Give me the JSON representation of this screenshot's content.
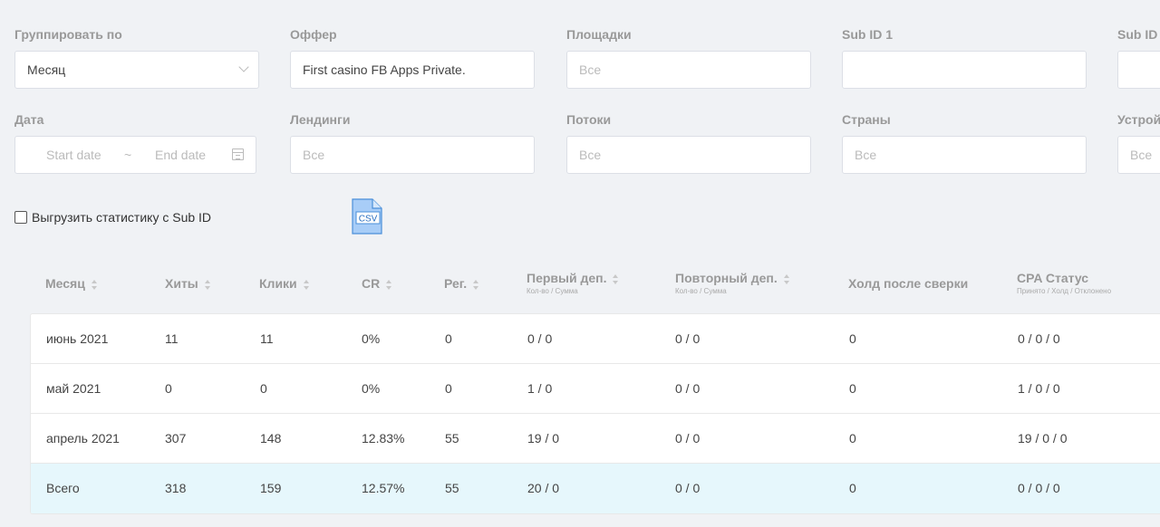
{
  "filters": {
    "group_by": {
      "label": "Группировать по",
      "value": "Месяц"
    },
    "offer": {
      "label": "Оффер",
      "value": "First casino FB Apps Private."
    },
    "platforms": {
      "label": "Площадки",
      "placeholder": "Все"
    },
    "sub_id_1": {
      "label": "Sub ID 1",
      "value": ""
    },
    "sub_id_2": {
      "label": "Sub ID",
      "value": ""
    },
    "date": {
      "label": "Дата",
      "start_placeholder": "Start date",
      "separator": "~",
      "end_placeholder": "End date"
    },
    "landings": {
      "label": "Лендинги",
      "placeholder": "Все"
    },
    "streams": {
      "label": "Потоки",
      "placeholder": "Все"
    },
    "countries": {
      "label": "Страны",
      "placeholder": "Все"
    },
    "devices": {
      "label": "Устрой",
      "placeholder": "Все"
    }
  },
  "export": {
    "label": "Выгрузить статистику с Sub ID",
    "checked": false,
    "csv_label": "CSV"
  },
  "table": {
    "headers": {
      "month": "Месяц",
      "hits": "Хиты",
      "clicks": "Клики",
      "cr": "CR",
      "reg": "Рег.",
      "first_dep": "Первый деп.",
      "first_dep_sub": "Кол-во / Сумма",
      "repeat_dep": "Повторный деп.",
      "repeat_dep_sub": "Кол-во / Сумма",
      "hold": "Холд после сверки",
      "cpa": "CPA Статус",
      "cpa_sub": "Принято / Холд / Отклонено"
    },
    "rows": [
      {
        "month": "июнь 2021",
        "hits": "11",
        "clicks": "11",
        "cr": "0%",
        "reg": "0",
        "first_dep": "0 / 0",
        "repeat_dep": "0 / 0",
        "hold": "0",
        "cpa": "0 / 0 / 0"
      },
      {
        "month": "май 2021",
        "hits": "0",
        "clicks": "0",
        "cr": "0%",
        "reg": "0",
        "first_dep": "1 / 0",
        "repeat_dep": "0 / 0",
        "hold": "0",
        "cpa": "1 / 0 / 0"
      },
      {
        "month": "апрель 2021",
        "hits": "307",
        "clicks": "148",
        "cr": "12.83%",
        "reg": "55",
        "first_dep": "19 / 0",
        "repeat_dep": "0 / 0",
        "hold": "0",
        "cpa": "19 / 0 / 0"
      }
    ],
    "total": {
      "month": "Всего",
      "hits": "318",
      "clicks": "159",
      "cr": "12.57%",
      "reg": "55",
      "first_dep": "20 / 0",
      "repeat_dep": "0 / 0",
      "hold": "0",
      "cpa": "0 / 0 / 0"
    }
  }
}
